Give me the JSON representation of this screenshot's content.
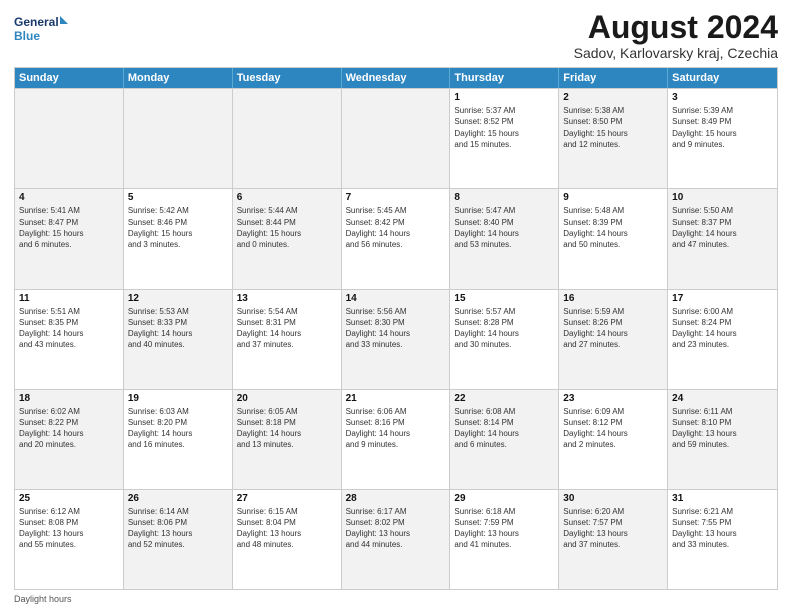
{
  "logo": {
    "line1": "General",
    "line2": "Blue"
  },
  "title": "August 2024",
  "subtitle": "Sadov, Karlovarsky kraj, Czechia",
  "weekdays": [
    "Sunday",
    "Monday",
    "Tuesday",
    "Wednesday",
    "Thursday",
    "Friday",
    "Saturday"
  ],
  "footer": "Daylight hours",
  "weeks": [
    [
      {
        "day": "",
        "info": "",
        "shaded": true
      },
      {
        "day": "",
        "info": "",
        "shaded": true
      },
      {
        "day": "",
        "info": "",
        "shaded": true
      },
      {
        "day": "",
        "info": "",
        "shaded": true
      },
      {
        "day": "1",
        "info": "Sunrise: 5:37 AM\nSunset: 8:52 PM\nDaylight: 15 hours\nand 15 minutes."
      },
      {
        "day": "2",
        "info": "Sunrise: 5:38 AM\nSunset: 8:50 PM\nDaylight: 15 hours\nand 12 minutes.",
        "shaded": true
      },
      {
        "day": "3",
        "info": "Sunrise: 5:39 AM\nSunset: 8:49 PM\nDaylight: 15 hours\nand 9 minutes."
      }
    ],
    [
      {
        "day": "4",
        "info": "Sunrise: 5:41 AM\nSunset: 8:47 PM\nDaylight: 15 hours\nand 6 minutes.",
        "shaded": true
      },
      {
        "day": "5",
        "info": "Sunrise: 5:42 AM\nSunset: 8:46 PM\nDaylight: 15 hours\nand 3 minutes."
      },
      {
        "day": "6",
        "info": "Sunrise: 5:44 AM\nSunset: 8:44 PM\nDaylight: 15 hours\nand 0 minutes.",
        "shaded": true
      },
      {
        "day": "7",
        "info": "Sunrise: 5:45 AM\nSunset: 8:42 PM\nDaylight: 14 hours\nand 56 minutes."
      },
      {
        "day": "8",
        "info": "Sunrise: 5:47 AM\nSunset: 8:40 PM\nDaylight: 14 hours\nand 53 minutes.",
        "shaded": true
      },
      {
        "day": "9",
        "info": "Sunrise: 5:48 AM\nSunset: 8:39 PM\nDaylight: 14 hours\nand 50 minutes."
      },
      {
        "day": "10",
        "info": "Sunrise: 5:50 AM\nSunset: 8:37 PM\nDaylight: 14 hours\nand 47 minutes.",
        "shaded": true
      }
    ],
    [
      {
        "day": "11",
        "info": "Sunrise: 5:51 AM\nSunset: 8:35 PM\nDaylight: 14 hours\nand 43 minutes."
      },
      {
        "day": "12",
        "info": "Sunrise: 5:53 AM\nSunset: 8:33 PM\nDaylight: 14 hours\nand 40 minutes.",
        "shaded": true
      },
      {
        "day": "13",
        "info": "Sunrise: 5:54 AM\nSunset: 8:31 PM\nDaylight: 14 hours\nand 37 minutes."
      },
      {
        "day": "14",
        "info": "Sunrise: 5:56 AM\nSunset: 8:30 PM\nDaylight: 14 hours\nand 33 minutes.",
        "shaded": true
      },
      {
        "day": "15",
        "info": "Sunrise: 5:57 AM\nSunset: 8:28 PM\nDaylight: 14 hours\nand 30 minutes."
      },
      {
        "day": "16",
        "info": "Sunrise: 5:59 AM\nSunset: 8:26 PM\nDaylight: 14 hours\nand 27 minutes.",
        "shaded": true
      },
      {
        "day": "17",
        "info": "Sunrise: 6:00 AM\nSunset: 8:24 PM\nDaylight: 14 hours\nand 23 minutes."
      }
    ],
    [
      {
        "day": "18",
        "info": "Sunrise: 6:02 AM\nSunset: 8:22 PM\nDaylight: 14 hours\nand 20 minutes.",
        "shaded": true
      },
      {
        "day": "19",
        "info": "Sunrise: 6:03 AM\nSunset: 8:20 PM\nDaylight: 14 hours\nand 16 minutes."
      },
      {
        "day": "20",
        "info": "Sunrise: 6:05 AM\nSunset: 8:18 PM\nDaylight: 14 hours\nand 13 minutes.",
        "shaded": true
      },
      {
        "day": "21",
        "info": "Sunrise: 6:06 AM\nSunset: 8:16 PM\nDaylight: 14 hours\nand 9 minutes."
      },
      {
        "day": "22",
        "info": "Sunrise: 6:08 AM\nSunset: 8:14 PM\nDaylight: 14 hours\nand 6 minutes.",
        "shaded": true
      },
      {
        "day": "23",
        "info": "Sunrise: 6:09 AM\nSunset: 8:12 PM\nDaylight: 14 hours\nand 2 minutes."
      },
      {
        "day": "24",
        "info": "Sunrise: 6:11 AM\nSunset: 8:10 PM\nDaylight: 13 hours\nand 59 minutes.",
        "shaded": true
      }
    ],
    [
      {
        "day": "25",
        "info": "Sunrise: 6:12 AM\nSunset: 8:08 PM\nDaylight: 13 hours\nand 55 minutes."
      },
      {
        "day": "26",
        "info": "Sunrise: 6:14 AM\nSunset: 8:06 PM\nDaylight: 13 hours\nand 52 minutes.",
        "shaded": true
      },
      {
        "day": "27",
        "info": "Sunrise: 6:15 AM\nSunset: 8:04 PM\nDaylight: 13 hours\nand 48 minutes."
      },
      {
        "day": "28",
        "info": "Sunrise: 6:17 AM\nSunset: 8:02 PM\nDaylight: 13 hours\nand 44 minutes.",
        "shaded": true
      },
      {
        "day": "29",
        "info": "Sunrise: 6:18 AM\nSunset: 7:59 PM\nDaylight: 13 hours\nand 41 minutes."
      },
      {
        "day": "30",
        "info": "Sunrise: 6:20 AM\nSunset: 7:57 PM\nDaylight: 13 hours\nand 37 minutes.",
        "shaded": true
      },
      {
        "day": "31",
        "info": "Sunrise: 6:21 AM\nSunset: 7:55 PM\nDaylight: 13 hours\nand 33 minutes."
      }
    ]
  ]
}
